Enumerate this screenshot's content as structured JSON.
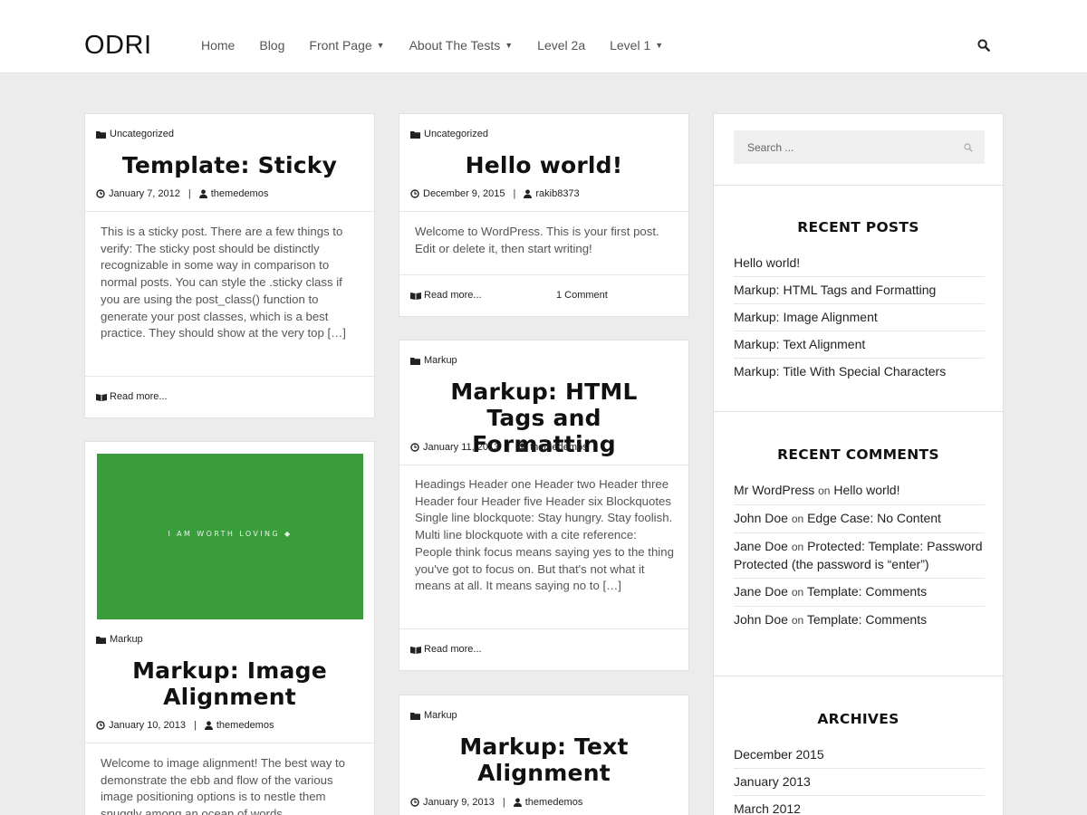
{
  "site": {
    "logo": "ODRI",
    "nav": [
      {
        "label": "Home",
        "has_caret": false
      },
      {
        "label": "Blog",
        "has_caret": false
      },
      {
        "label": "Front Page",
        "has_caret": true
      },
      {
        "label": "About The Tests",
        "has_caret": true
      },
      {
        "label": "Level 2a",
        "has_caret": false
      },
      {
        "label": "Level 1",
        "has_caret": true
      }
    ]
  },
  "posts": {
    "sticky": {
      "category": "Uncategorized",
      "title": "Template: Sticky",
      "date": "January 7, 2012",
      "author": "themedemos",
      "excerpt": "This is a sticky post. There are a few things to verify: The sticky post should be distinctly recognizable in some way in comparison to normal posts. You can style the .sticky class if you are using the post_class() function to generate your post classes, which is a best practice. They should show at the very top […]",
      "read_more": "Read more..."
    },
    "image_alignment": {
      "image_text": "I AM WORTH LOVING",
      "category": "Markup",
      "title": "Markup: Image Alignment",
      "date": "January 10, 2013",
      "author": "themedemos",
      "excerpt": "Welcome to image alignment! The best way to demonstrate the ebb and flow of the various image positioning options is to nestle them snuggly among an ocean of words."
    },
    "hello": {
      "category": "Uncategorized",
      "title": "Hello world!",
      "date": "December 9, 2015",
      "author": "rakib8373",
      "excerpt": "Welcome to WordPress. This is your first post. Edit or delete it, then start writing!",
      "read_more": "Read more...",
      "comments": "1 Comment"
    },
    "html_tags": {
      "category": "Markup",
      "title": "Markup: HTML Tags and Formatting",
      "date": "January 11, 2013",
      "author": "themedemos",
      "excerpt": "Headings Header one Header two Header three Header four Header five Header six Blockquotes Single line blockquote: Stay hungry. Stay foolish. Multi line blockquote with a cite reference: People think focus means saying yes to the thing you've got to focus on. But that's not what it means at all. It means saying no to […]",
      "read_more": "Read more..."
    },
    "text_alignment": {
      "category": "Markup",
      "title": "Markup: Text Alignment",
      "date": "January 9, 2013",
      "author": "themedemos"
    }
  },
  "sidebar": {
    "search_placeholder": "Search ...",
    "recent_posts": {
      "title": "RECENT POSTS",
      "items": [
        "Hello world!",
        "Markup: HTML Tags and Formatting",
        "Markup: Image Alignment",
        "Markup: Text Alignment",
        "Markup: Title With Special Characters"
      ]
    },
    "recent_comments": {
      "title": "RECENT COMMENTS",
      "on_word": "on",
      "items": [
        {
          "author": "Mr WordPress",
          "post": "Hello world!"
        },
        {
          "author": "John Doe",
          "post": "Edge Case: No Content"
        },
        {
          "author": "Jane Doe",
          "post": "Protected: Template: Password Protected (the password is “enter”)"
        },
        {
          "author": "Jane Doe",
          "post": "Template: Comments"
        },
        {
          "author": "John Doe",
          "post": "Template: Comments"
        }
      ]
    },
    "archives": {
      "title": "ARCHIVES",
      "items": [
        "December 2015",
        "January 2013",
        "March 2012"
      ]
    }
  },
  "colors": {
    "accent_red": "#d0021b",
    "image_green": "#3a9d3b",
    "page_bg": "#ececec"
  }
}
